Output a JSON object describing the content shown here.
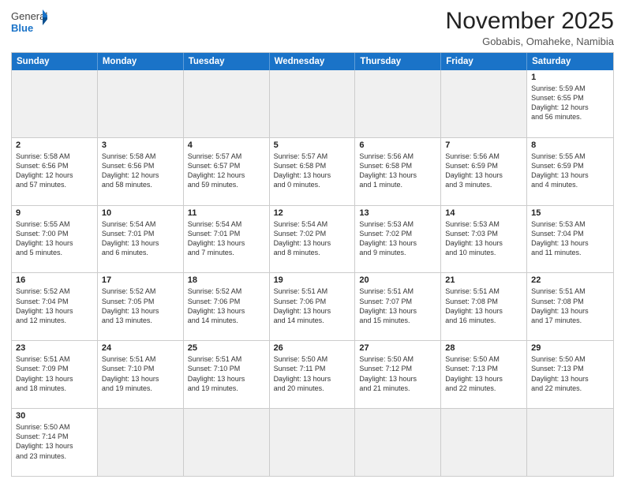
{
  "logo": {
    "text_general": "General",
    "text_blue": "Blue"
  },
  "title": "November 2025",
  "location": "Gobabis, Omaheke, Namibia",
  "header_days": [
    "Sunday",
    "Monday",
    "Tuesday",
    "Wednesday",
    "Thursday",
    "Friday",
    "Saturday"
  ],
  "rows": [
    [
      {
        "day": "",
        "info": "",
        "empty": true
      },
      {
        "day": "",
        "info": "",
        "empty": true
      },
      {
        "day": "",
        "info": "",
        "empty": true
      },
      {
        "day": "",
        "info": "",
        "empty": true
      },
      {
        "day": "",
        "info": "",
        "empty": true
      },
      {
        "day": "",
        "info": "",
        "empty": true
      },
      {
        "day": "1",
        "info": "Sunrise: 5:59 AM\nSunset: 6:55 PM\nDaylight: 12 hours\nand 56 minutes.",
        "empty": false
      }
    ],
    [
      {
        "day": "2",
        "info": "Sunrise: 5:58 AM\nSunset: 6:56 PM\nDaylight: 12 hours\nand 57 minutes.",
        "empty": false
      },
      {
        "day": "3",
        "info": "Sunrise: 5:58 AM\nSunset: 6:56 PM\nDaylight: 12 hours\nand 58 minutes.",
        "empty": false
      },
      {
        "day": "4",
        "info": "Sunrise: 5:57 AM\nSunset: 6:57 PM\nDaylight: 12 hours\nand 59 minutes.",
        "empty": false
      },
      {
        "day": "5",
        "info": "Sunrise: 5:57 AM\nSunset: 6:58 PM\nDaylight: 13 hours\nand 0 minutes.",
        "empty": false
      },
      {
        "day": "6",
        "info": "Sunrise: 5:56 AM\nSunset: 6:58 PM\nDaylight: 13 hours\nand 1 minute.",
        "empty": false
      },
      {
        "day": "7",
        "info": "Sunrise: 5:56 AM\nSunset: 6:59 PM\nDaylight: 13 hours\nand 3 minutes.",
        "empty": false
      },
      {
        "day": "8",
        "info": "Sunrise: 5:55 AM\nSunset: 6:59 PM\nDaylight: 13 hours\nand 4 minutes.",
        "empty": false
      }
    ],
    [
      {
        "day": "9",
        "info": "Sunrise: 5:55 AM\nSunset: 7:00 PM\nDaylight: 13 hours\nand 5 minutes.",
        "empty": false
      },
      {
        "day": "10",
        "info": "Sunrise: 5:54 AM\nSunset: 7:01 PM\nDaylight: 13 hours\nand 6 minutes.",
        "empty": false
      },
      {
        "day": "11",
        "info": "Sunrise: 5:54 AM\nSunset: 7:01 PM\nDaylight: 13 hours\nand 7 minutes.",
        "empty": false
      },
      {
        "day": "12",
        "info": "Sunrise: 5:54 AM\nSunset: 7:02 PM\nDaylight: 13 hours\nand 8 minutes.",
        "empty": false
      },
      {
        "day": "13",
        "info": "Sunrise: 5:53 AM\nSunset: 7:02 PM\nDaylight: 13 hours\nand 9 minutes.",
        "empty": false
      },
      {
        "day": "14",
        "info": "Sunrise: 5:53 AM\nSunset: 7:03 PM\nDaylight: 13 hours\nand 10 minutes.",
        "empty": false
      },
      {
        "day": "15",
        "info": "Sunrise: 5:53 AM\nSunset: 7:04 PM\nDaylight: 13 hours\nand 11 minutes.",
        "empty": false
      }
    ],
    [
      {
        "day": "16",
        "info": "Sunrise: 5:52 AM\nSunset: 7:04 PM\nDaylight: 13 hours\nand 12 minutes.",
        "empty": false
      },
      {
        "day": "17",
        "info": "Sunrise: 5:52 AM\nSunset: 7:05 PM\nDaylight: 13 hours\nand 13 minutes.",
        "empty": false
      },
      {
        "day": "18",
        "info": "Sunrise: 5:52 AM\nSunset: 7:06 PM\nDaylight: 13 hours\nand 14 minutes.",
        "empty": false
      },
      {
        "day": "19",
        "info": "Sunrise: 5:51 AM\nSunset: 7:06 PM\nDaylight: 13 hours\nand 14 minutes.",
        "empty": false
      },
      {
        "day": "20",
        "info": "Sunrise: 5:51 AM\nSunset: 7:07 PM\nDaylight: 13 hours\nand 15 minutes.",
        "empty": false
      },
      {
        "day": "21",
        "info": "Sunrise: 5:51 AM\nSunset: 7:08 PM\nDaylight: 13 hours\nand 16 minutes.",
        "empty": false
      },
      {
        "day": "22",
        "info": "Sunrise: 5:51 AM\nSunset: 7:08 PM\nDaylight: 13 hours\nand 17 minutes.",
        "empty": false
      }
    ],
    [
      {
        "day": "23",
        "info": "Sunrise: 5:51 AM\nSunset: 7:09 PM\nDaylight: 13 hours\nand 18 minutes.",
        "empty": false
      },
      {
        "day": "24",
        "info": "Sunrise: 5:51 AM\nSunset: 7:10 PM\nDaylight: 13 hours\nand 19 minutes.",
        "empty": false
      },
      {
        "day": "25",
        "info": "Sunrise: 5:51 AM\nSunset: 7:10 PM\nDaylight: 13 hours\nand 19 minutes.",
        "empty": false
      },
      {
        "day": "26",
        "info": "Sunrise: 5:50 AM\nSunset: 7:11 PM\nDaylight: 13 hours\nand 20 minutes.",
        "empty": false
      },
      {
        "day": "27",
        "info": "Sunrise: 5:50 AM\nSunset: 7:12 PM\nDaylight: 13 hours\nand 21 minutes.",
        "empty": false
      },
      {
        "day": "28",
        "info": "Sunrise: 5:50 AM\nSunset: 7:13 PM\nDaylight: 13 hours\nand 22 minutes.",
        "empty": false
      },
      {
        "day": "29",
        "info": "Sunrise: 5:50 AM\nSunset: 7:13 PM\nDaylight: 13 hours\nand 22 minutes.",
        "empty": false
      }
    ],
    [
      {
        "day": "30",
        "info": "Sunrise: 5:50 AM\nSunset: 7:14 PM\nDaylight: 13 hours\nand 23 minutes.",
        "empty": false
      },
      {
        "day": "",
        "info": "",
        "empty": true
      },
      {
        "day": "",
        "info": "",
        "empty": true
      },
      {
        "day": "",
        "info": "",
        "empty": true
      },
      {
        "day": "",
        "info": "",
        "empty": true
      },
      {
        "day": "",
        "info": "",
        "empty": true
      },
      {
        "day": "",
        "info": "",
        "empty": true
      }
    ]
  ]
}
